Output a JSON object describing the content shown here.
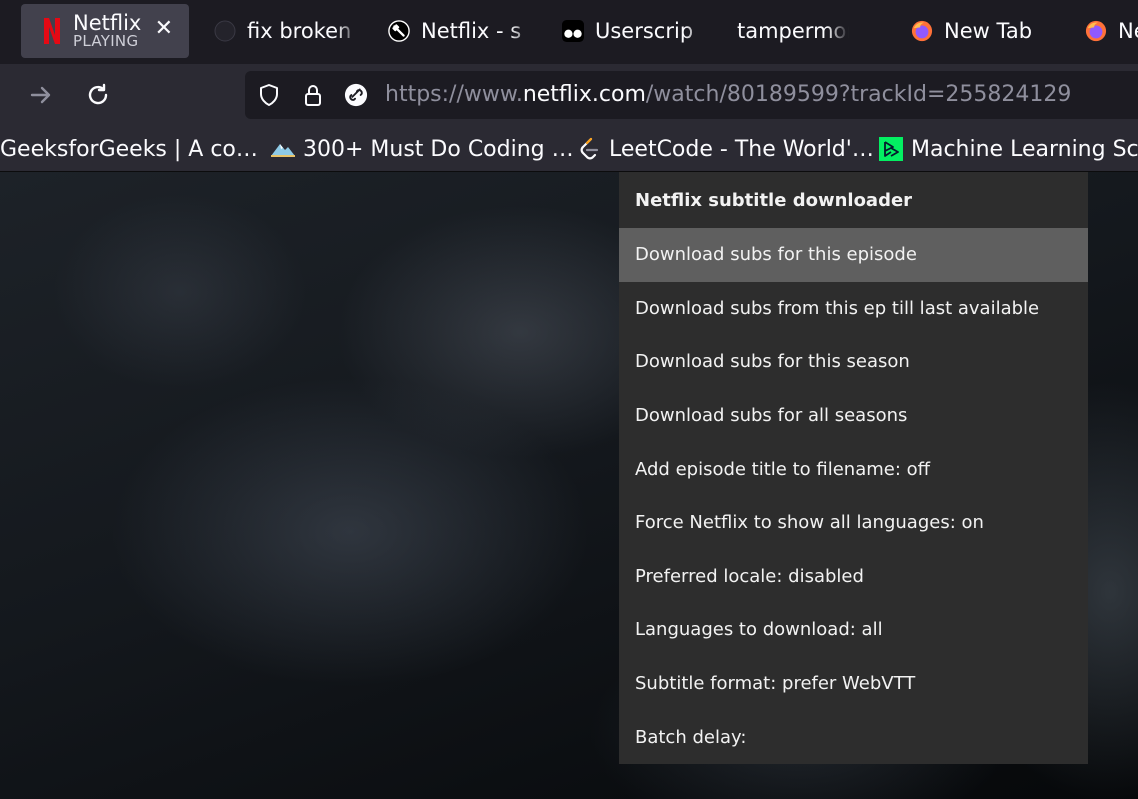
{
  "tabs": [
    {
      "title": "Netflix",
      "subtitle": "PLAYING",
      "active": true,
      "icon": "netflix-logo-icon"
    },
    {
      "title": "fix broken",
      "icon": "github-icon"
    },
    {
      "title": "Netflix - s",
      "icon": "greasyfork-icon"
    },
    {
      "title": "Userscrip",
      "icon": "tampermonkey-icon"
    },
    {
      "title": "tampermonk",
      "icon": ""
    },
    {
      "title": "New Tab",
      "icon": "firefox-icon"
    },
    {
      "title": "Ne",
      "icon": "firefox-icon"
    }
  ],
  "url": {
    "prefix": "https://www.",
    "host": "netflix.com",
    "path": "/watch/80189599?trackId=255824129"
  },
  "bookmarks": [
    {
      "label": "GeeksforGeeks | A co…",
      "icon": ""
    },
    {
      "label": "300+ Must Do Coding …",
      "icon": "mountain-icon"
    },
    {
      "label": "LeetCode - The World'…",
      "icon": "leetcode-icon"
    },
    {
      "label": "Machine Learning Scie",
      "icon": "datacamp-icon"
    }
  ],
  "menu": {
    "title": "Netflix subtitle downloader",
    "items": [
      "Download subs for this episode",
      "Download subs from this ep till last available",
      "Download subs for this season",
      "Download subs for all seasons",
      "Add episode title to filename: off",
      "Force Netflix to show all languages: on",
      "Preferred locale: disabled",
      "Languages to download: all",
      "Subtitle format: prefer WebVTT",
      "Batch delay:"
    ],
    "highlighted_index": 0
  },
  "colors": {
    "netflix_red": "#e50914",
    "tabbar_bg": "#1c1b22",
    "toolbar_bg": "#2b2a33",
    "menu_bg": "#2d2d2d",
    "menu_highlight": "#5f5f5f"
  }
}
